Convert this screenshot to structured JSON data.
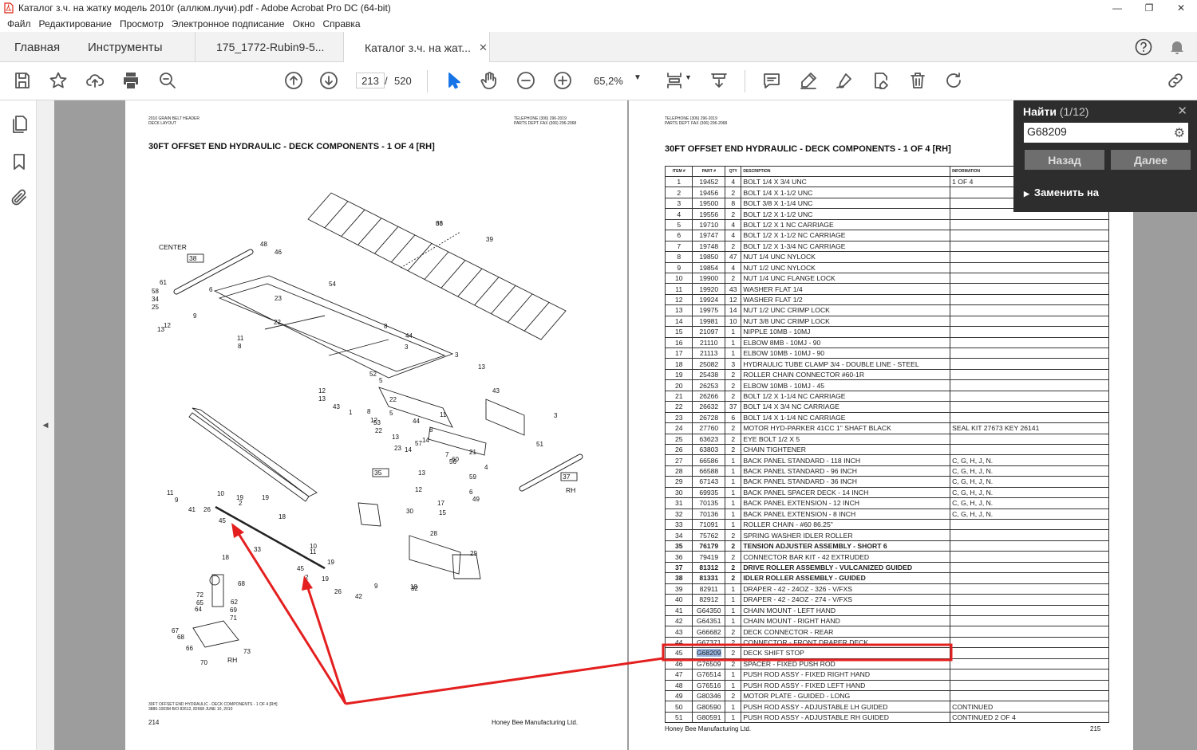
{
  "window": {
    "title": "Каталог з.ч. на жатку модель 2010г (аллюм.лучи).pdf - Adobe Acrobat Pro DC (64-bit)",
    "min": "—",
    "max": "❐",
    "close": "✕"
  },
  "menu": [
    "Файл",
    "Редактирование",
    "Просмотр",
    "Электронное подписание",
    "Окно",
    "Справка"
  ],
  "tabs": {
    "home": "Главная",
    "tools": "Инструменты",
    "doc1": "175_1772-Rubin9-5...",
    "doc2": "Каталог з.ч. на жат...",
    "close": "✕"
  },
  "toolbar": {
    "page_current": "213",
    "page_sep": "/",
    "page_total": "520",
    "zoom": "65,2%"
  },
  "find": {
    "title": "Найти",
    "count": "(1/12)",
    "query": "G68209",
    "back": "Назад",
    "next": "Далее",
    "replace": "Заменить на"
  },
  "left_page": {
    "header_left": "2010 GRAIN BELT HEADER\nDECK LAYOUT",
    "header_right": "TELEPHONE (306) 296-2019\nPARTS DEPT. FAX (306) 296-2068",
    "title": "30FT OFFSET END HYDRAULIC - DECK COMPONENTS - 1 OF 4 [RH]",
    "footer_caption": "30FT OFFSET END HYDRAULIC - DECK COMPONENTS - 1 OF 4 [RH]\n3886-1003M B/O 82612, 82668 JUNE 10, 2010",
    "page_number": "214",
    "company": "Honey Bee Manufacturing Ltd.",
    "labels": {
      "center": "CENTER",
      "rh1": "RH",
      "rh2": "RH",
      "box38": "38",
      "box35": "35",
      "box37": "37"
    },
    "callouts": [
      "36",
      "39",
      "48",
      "46",
      "54",
      "61",
      "58",
      "34",
      "25",
      "6",
      "23",
      "9",
      "12",
      "13",
      "22",
      "11",
      "8",
      "8",
      "44",
      "3",
      "3",
      "52",
      "5",
      "22",
      "5",
      "12",
      "13",
      "43",
      "1",
      "8",
      "12",
      "13",
      "43",
      "11",
      "44",
      "8",
      "53",
      "22",
      "13",
      "23",
      "57",
      "7",
      "56",
      "14",
      "14",
      "3",
      "51",
      "60",
      "21",
      "13",
      "4",
      "59",
      "12",
      "6",
      "49",
      "15",
      "17",
      "30",
      "28",
      "19",
      "10",
      "11",
      "9",
      "41",
      "26",
      "19",
      "2",
      "45",
      "18",
      "33",
      "10",
      "11",
      "19",
      "45",
      "2",
      "19",
      "26",
      "42",
      "18",
      "9",
      "29",
      "32",
      "18",
      "68",
      "72",
      "65",
      "64",
      "62",
      "69",
      "71",
      "67",
      "68",
      "66",
      "73",
      "70",
      "63"
    ]
  },
  "right_page": {
    "header": "TELEPHONE (306) 296-2019\nPARTS DEPT. FAX (306) 296-2068",
    "title": "30FT OFFSET END HYDRAULIC - DECK COMPONENTS - 1 OF 4 [RH]",
    "columns": [
      "ITEM #",
      "PART #",
      "QTY",
      "DESCRIPTION",
      "INFORMATION"
    ],
    "rows": [
      [
        "1",
        "19452",
        "4",
        "BOLT 1/4 X 3/4 UNC",
        "1 OF 4"
      ],
      [
        "2",
        "19456",
        "2",
        "BOLT 1/4 X 1-1/2 UNC",
        ""
      ],
      [
        "3",
        "19500",
        "8",
        "BOLT 3/8 X 1-1/4 UNC",
        ""
      ],
      [
        "4",
        "19556",
        "2",
        "BOLT 1/2 X 1-1/2 UNC",
        ""
      ],
      [
        "5",
        "19710",
        "4",
        "BOLT 1/2 X 1 NC CARRIAGE",
        ""
      ],
      [
        "6",
        "19747",
        "4",
        "BOLT 1/2 X 1-1/2 NC CARRIAGE",
        ""
      ],
      [
        "7",
        "19748",
        "2",
        "BOLT 1/2 X 1-3/4 NC CARRIAGE",
        ""
      ],
      [
        "8",
        "19850",
        "47",
        "NUT 1/4 UNC NYLOCK",
        ""
      ],
      [
        "9",
        "19854",
        "4",
        "NUT 1/2 UNC NYLOCK",
        ""
      ],
      [
        "10",
        "19900",
        "2",
        "NUT 1/4 UNC FLANGE LOCK",
        ""
      ],
      [
        "11",
        "19920",
        "43",
        "WASHER FLAT 1/4",
        ""
      ],
      [
        "12",
        "19924",
        "12",
        "WASHER FLAT 1/2",
        ""
      ],
      [
        "13",
        "19975",
        "14",
        "NUT 1/2 UNC CRIMP LOCK",
        ""
      ],
      [
        "14",
        "19981",
        "10",
        "NUT 3/8 UNC CRIMP LOCK",
        ""
      ],
      [
        "15",
        "21097",
        "1",
        "NIPPLE 10MB - 10MJ",
        ""
      ],
      [
        "16",
        "21110",
        "1",
        "ELBOW 8MB - 10MJ - 90",
        ""
      ],
      [
        "17",
        "21113",
        "1",
        "ELBOW 10MB - 10MJ - 90",
        ""
      ],
      [
        "18",
        "25082",
        "3",
        "HYDRAULIC TUBE CLAMP 3/4 - DOUBLE LINE - STEEL",
        ""
      ],
      [
        "19",
        "25438",
        "2",
        "ROLLER CHAIN CONNECTOR #60-1R",
        ""
      ],
      [
        "20",
        "26253",
        "2",
        "ELBOW 10MB - 10MJ - 45",
        ""
      ],
      [
        "21",
        "26266",
        "2",
        "BOLT 1/2 X 1-1/4 NC CARRIAGE",
        ""
      ],
      [
        "22",
        "26632",
        "37",
        "BOLT 1/4 X 3/4 NC CARRIAGE",
        ""
      ],
      [
        "23",
        "26728",
        "6",
        "BOLT 1/4 X 1-1/4 NC CARRIAGE",
        ""
      ],
      [
        "24",
        "27760",
        "2",
        "MOTOR HYD-PARKER 41CC 1\" SHAFT BLACK",
        "SEAL KIT 27673  KEY 26141"
      ],
      [
        "25",
        "63623",
        "2",
        "EYE BOLT 1/2 X 5",
        ""
      ],
      [
        "26",
        "63803",
        "2",
        "CHAIN TIGHTENER",
        ""
      ],
      [
        "27",
        "66586",
        "1",
        "BACK PANEL STANDARD - 118 INCH",
        "C, G, H, J, N."
      ],
      [
        "28",
        "66588",
        "1",
        "BACK PANEL STANDARD - 96 INCH",
        "C, G, H, J, N."
      ],
      [
        "29",
        "67143",
        "1",
        "BACK PANEL STANDARD - 36 INCH",
        "C, G, H, J, N."
      ],
      [
        "30",
        "69935",
        "1",
        "BACK PANEL SPACER DECK - 14 INCH",
        "C, G, H, J, N."
      ],
      [
        "31",
        "70135",
        "1",
        "BACK PANEL EXTENSION - 12 INCH",
        "C, G, H, J, N."
      ],
      [
        "32",
        "70136",
        "1",
        "BACK PANEL EXTENSION - 8 INCH",
        "C, G, H, J, N."
      ],
      [
        "33",
        "71091",
        "1",
        "ROLLER CHAIN - #60  86.25\"",
        ""
      ],
      [
        "34",
        "75762",
        "2",
        "SPRING WASHER IDLER ROLLER",
        ""
      ],
      [
        "35",
        "76179",
        "2",
        "TENSION ADJUSTER ASSEMBLY - SHORT 6",
        ""
      ],
      [
        "36",
        "79419",
        "2",
        "CONNECTOR BAR KIT - 42 EXTRUDED",
        ""
      ],
      [
        "37",
        "81312",
        "2",
        "DRIVE ROLLER ASSEMBLY - VULCANIZED GUIDED",
        ""
      ],
      [
        "38",
        "81331",
        "2",
        "IDLER ROLLER ASSEMBLY - GUIDED",
        ""
      ],
      [
        "39",
        "82911",
        "1",
        "DRAPER - 42 - 24OZ - 326 - V/FXS",
        ""
      ],
      [
        "40",
        "82912",
        "1",
        "DRAPER - 42 - 24OZ - 274 - V/FXS",
        ""
      ],
      [
        "41",
        "G64350",
        "1",
        "CHAIN MOUNT - LEFT HAND",
        ""
      ],
      [
        "42",
        "G64351",
        "1",
        "CHAIN MOUNT - RIGHT HAND",
        ""
      ],
      [
        "43",
        "G66682",
        "2",
        "DECK CONNECTOR - REAR",
        ""
      ],
      [
        "44",
        "G67371",
        "2",
        "CONNECTOR - FRONT DRAPER DECK",
        ""
      ],
      [
        "45",
        "G68209",
        "2",
        "DECK SHIFT STOP",
        ""
      ],
      [
        "46",
        "G76509",
        "2",
        "SPACER - FIXED PUSH ROD",
        ""
      ],
      [
        "47",
        "G76514",
        "1",
        "PUSH ROD ASSY - FIXED RIGHT HAND",
        ""
      ],
      [
        "48",
        "G76516",
        "1",
        "PUSH ROD ASSY - FIXED LEFT HAND",
        ""
      ],
      [
        "49",
        "G80346",
        "2",
        "MOTOR PLATE - GUIDED - LONG",
        ""
      ],
      [
        "50",
        "G80590",
        "1",
        "PUSH ROD ASSY - ADJUSTABLE LH GUIDED",
        "CONTINUED"
      ],
      [
        "51",
        "G80591",
        "1",
        "PUSH ROD ASSY - ADJUSTABLE RH GUIDED",
        "CONTINUED          2 OF 4"
      ]
    ],
    "bold_items": [
      "35",
      "37",
      "38"
    ],
    "highlight_item": "45",
    "company": "Honey Bee Manufacturing Ltd.",
    "page_number": "215"
  },
  "colors": {
    "annotation": "#e41f1f",
    "highlight": "#9ab8e3",
    "find_bg": "#2d2d2d"
  }
}
